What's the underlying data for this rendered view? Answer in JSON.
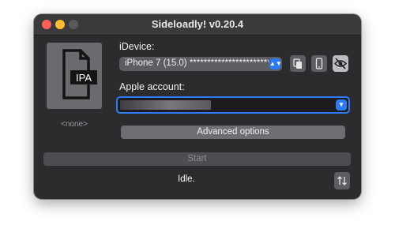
{
  "window": {
    "title": "Sideloadly! v0.20.4"
  },
  "ipa": {
    "icon": "ipa-file-icon",
    "icon_text": "IPA",
    "file_label": "<none>"
  },
  "device": {
    "label": "iDevice:",
    "selected": "iPhone 7 (15.0) ************************",
    "buttons": {
      "copy_icon": "copy-icon",
      "phone_icon": "phone-icon",
      "hide_icon": "eye-slash-icon"
    }
  },
  "account": {
    "label": "Apple account:",
    "value_state": "blurred"
  },
  "advanced": {
    "label": "Advanced options"
  },
  "start": {
    "label": "Start",
    "enabled": false
  },
  "status": {
    "text": "Idle."
  },
  "log": {
    "toggle_icon": "sort-arrows-icon"
  },
  "colors": {
    "window_bg": "#2c2c2e",
    "accent": "#2d7bf4",
    "close": "#fe5f57",
    "minimize": "#febc2e"
  }
}
